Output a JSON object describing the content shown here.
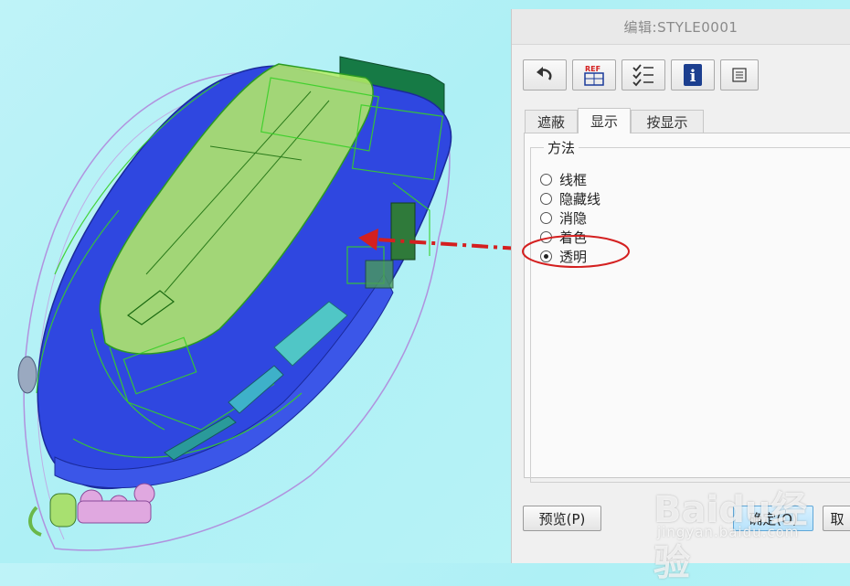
{
  "dialog": {
    "title": "编辑:STYLE0001",
    "toolbar": [
      {
        "name": "undo-icon"
      },
      {
        "name": "ref-icon",
        "text": "REF"
      },
      {
        "name": "checklist-icon"
      },
      {
        "name": "info-icon",
        "text": "i"
      },
      {
        "name": "list-icon"
      }
    ],
    "tabs": [
      {
        "label": "遮蔽",
        "active": false
      },
      {
        "label": "显示",
        "active": true
      },
      {
        "label": "按显示",
        "active": false
      }
    ],
    "method": {
      "title": "方法",
      "options": [
        {
          "label": "线框",
          "checked": false
        },
        {
          "label": "隐藏线",
          "checked": false
        },
        {
          "label": "消隐",
          "checked": false
        },
        {
          "label": "着色",
          "checked": false
        },
        {
          "label": "透明",
          "checked": true
        }
      ]
    },
    "buttons": {
      "preview": "预览(P)",
      "ok": "确定(O)",
      "cancel": "取"
    }
  },
  "watermark": {
    "brand": "Baidu经验",
    "url": "jingyan.baidu.com"
  },
  "colors": {
    "annotation": "#d42020",
    "model_blue": "#2f47e0",
    "model_green": "#33cc22"
  }
}
